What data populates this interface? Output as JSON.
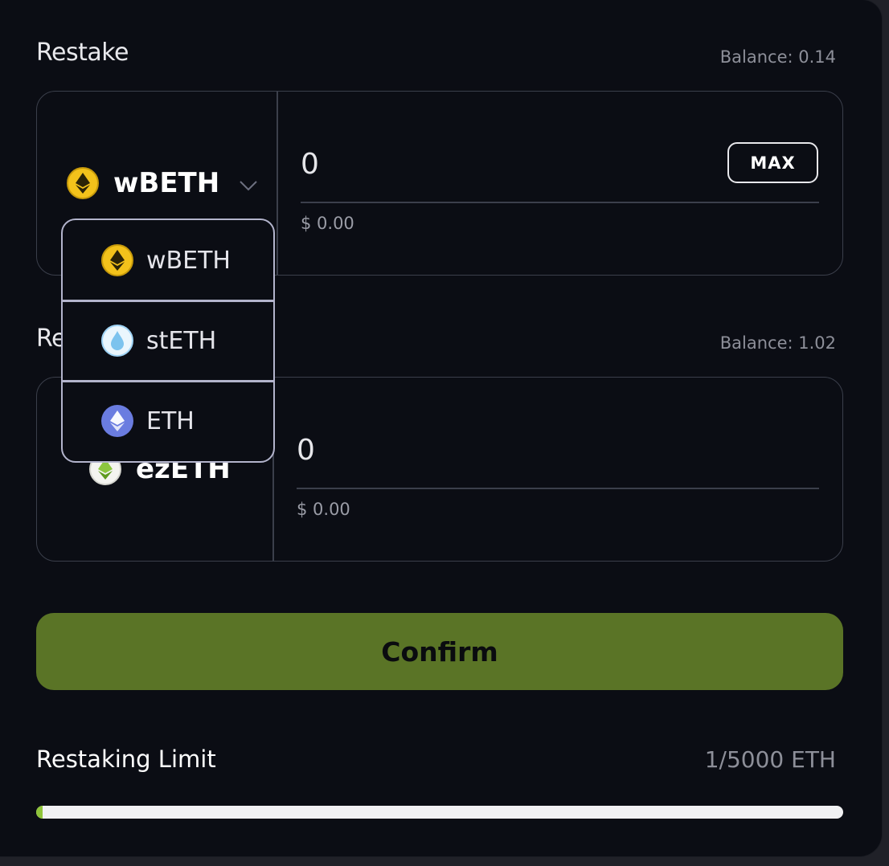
{
  "restake": {
    "label": "Restake",
    "balance": "Balance: 0.14",
    "token": "wBETH",
    "amount": "0",
    "usd": "$ 0.00",
    "max_label": "MAX"
  },
  "receive": {
    "label_visible": "Re",
    "balance": "Balance: 1.02",
    "token": "ezETH",
    "amount": "0",
    "usd": "$ 0.00"
  },
  "dropdown": {
    "items": [
      {
        "label": "wBETH",
        "icon": "wbeth-icon",
        "color": "#f3c21b"
      },
      {
        "label": "stETH",
        "icon": "steth-icon",
        "color": "#9fd3f5"
      },
      {
        "label": "ETH",
        "icon": "eth-icon",
        "color": "#6a7ce0"
      }
    ]
  },
  "confirm": {
    "label": "Confirm"
  },
  "restaking_limit": {
    "label": "Restaking Limit",
    "value": "1/5000 ETH",
    "progress_fraction": 0.0002
  },
  "colors": {
    "accent_green": "#5a7426",
    "progress_green": "#8fc43a",
    "background": "#0b0d14"
  }
}
